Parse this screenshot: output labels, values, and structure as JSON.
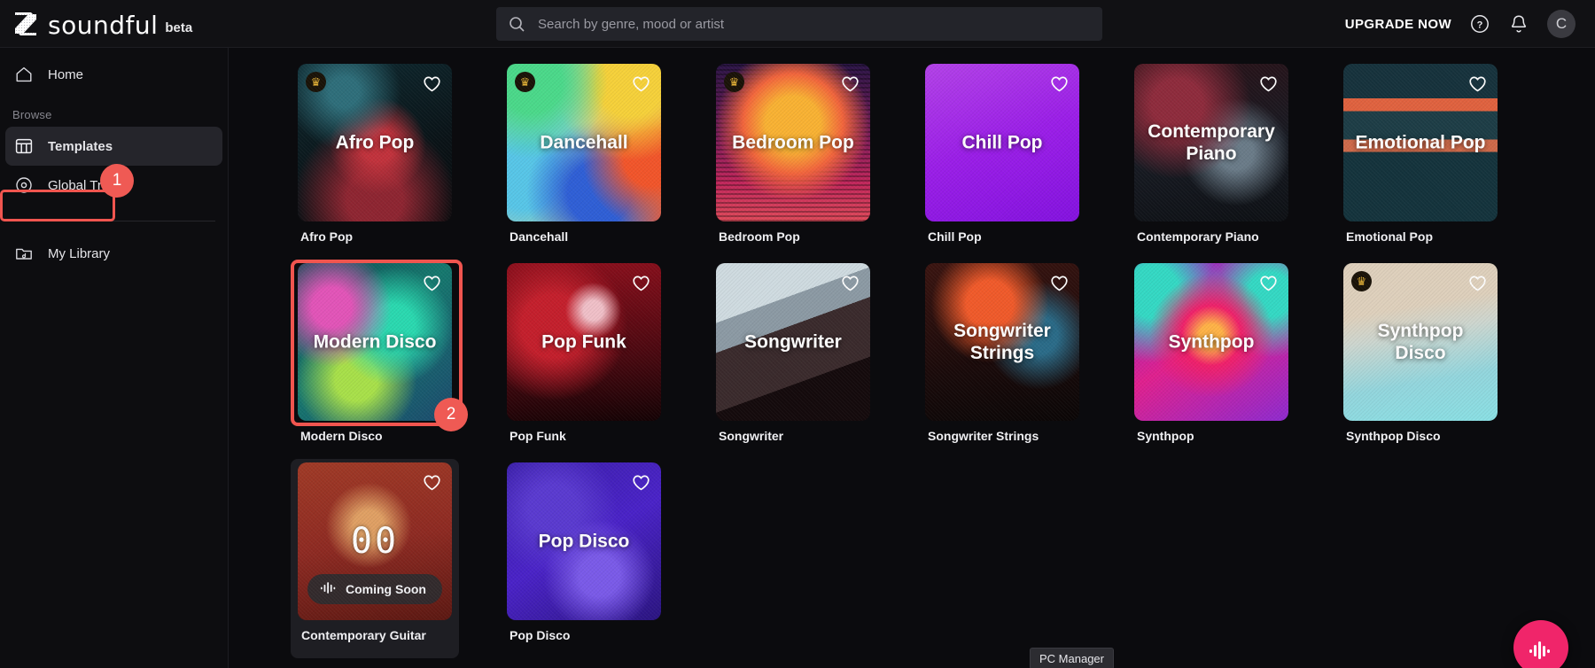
{
  "brand": {
    "word": "soundful",
    "beta": "beta",
    "logo_icon": "soundful-logo-icon"
  },
  "search": {
    "value": "",
    "placeholder": "Search by genre, mood or artist",
    "icon": "search-icon"
  },
  "topbar": {
    "upgrade_label": "UPGRADE NOW",
    "help_icon": "help-circle-icon",
    "notifications_icon": "bell-icon",
    "avatar_initial": "C"
  },
  "sidebar": {
    "home": {
      "label": "Home",
      "icon": "home-icon"
    },
    "section_label": "Browse",
    "templates": {
      "label": "Templates",
      "icon": "table-grid-icon"
    },
    "global_tracks": {
      "label": "Global Tracks",
      "icon": "disc-icon"
    },
    "my_library": {
      "label": "My Library",
      "icon": "folder-music-icon"
    }
  },
  "annotations": {
    "step1": "1",
    "step2": "2",
    "highlight_color": "#f0554f",
    "badge_color": "#ef5a54"
  },
  "taskbar": {
    "tooltip": "PC Manager"
  },
  "fab": {
    "icon": "waveform-icon",
    "color": "#f0256a"
  },
  "cards": [
    {
      "title": "Afro Pop",
      "caption": "Afro Pop",
      "art": "art-afro",
      "premium": true,
      "favorite": false
    },
    {
      "title": "Dancehall",
      "caption": "Dancehall",
      "art": "art-dancehall",
      "premium": true,
      "favorite": false
    },
    {
      "title": "Bedroom Pop",
      "caption": "Bedroom Pop",
      "art": "art-bedroom",
      "premium": true,
      "favorite": false
    },
    {
      "title": "Chill Pop",
      "caption": "Chill Pop",
      "art": "art-chill",
      "premium": false,
      "favorite": false
    },
    {
      "title": "Contemporary Piano",
      "caption": "Contemporary Piano",
      "art": "art-piano",
      "premium": false,
      "favorite": false
    },
    {
      "title": "Emotional Pop",
      "caption": "Emotional Pop",
      "art": "art-emotional",
      "premium": false,
      "favorite": false
    },
    {
      "title": "Modern Disco",
      "caption": "Modern Disco",
      "art": "art-modern",
      "premium": false,
      "favorite": false,
      "selected": true
    },
    {
      "title": "Pop Funk",
      "caption": "Pop Funk",
      "art": "art-popfunk",
      "premium": false,
      "favorite": false
    },
    {
      "title": "Songwriter",
      "caption": "Songwriter",
      "art": "art-songwriter",
      "premium": false,
      "favorite": false
    },
    {
      "title": "Songwriter Strings",
      "caption": "Songwriter Strings",
      "art": "art-sws",
      "premium": false,
      "favorite": false
    },
    {
      "title": "Synthpop",
      "caption": "Synthpop",
      "art": "art-synthpop",
      "premium": false,
      "favorite": false
    },
    {
      "title": "Synthpop Disco",
      "caption": "Synthpop Disco",
      "art": "art-synthdisco",
      "premium": true,
      "favorite": false
    },
    {
      "title": "",
      "caption": "Contemporary Guitar",
      "art": "art-guitar",
      "premium": false,
      "favorite": false,
      "coming_soon": true,
      "coming_soon_label": "Coming Soon",
      "coming_soon_icon": "waveform-icon",
      "placeholder_counter": "00"
    },
    {
      "title": "Pop Disco",
      "caption": "Pop Disco",
      "art": "art-popdisco",
      "premium": false,
      "favorite": false
    }
  ]
}
